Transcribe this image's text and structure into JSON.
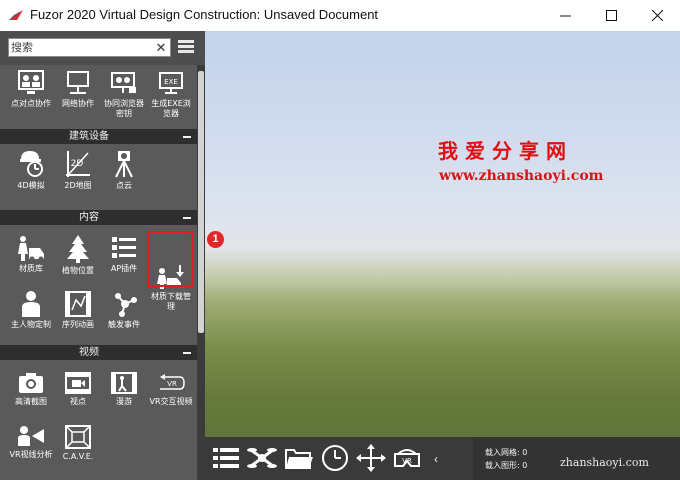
{
  "window": {
    "title": "Fuzor 2020 Virtual Design Construction: Unsaved Document",
    "minimize_glyph": "—",
    "maximize_glyph": "☐",
    "close_glyph": "✕"
  },
  "search": {
    "placeholder": "搜索",
    "clear_glyph": "✕"
  },
  "categories": {
    "top_tools": [
      {
        "label": "点对点协作",
        "icon": "peer-collab-icon"
      },
      {
        "label": "网络协作",
        "icon": "network-collab-icon"
      },
      {
        "label": "协同浏览器密钥",
        "icon": "browser-key-icon"
      },
      {
        "label": "生成EXE浏览器",
        "icon": "exe-viewer-icon"
      }
    ],
    "building": {
      "title": "建筑设备",
      "tools": [
        {
          "label": "4D模拟",
          "icon": "4d-sim-icon"
        },
        {
          "label": "2D地图",
          "icon": "2d-map-icon"
        },
        {
          "label": "点云",
          "icon": "point-cloud-icon"
        }
      ]
    },
    "content": {
      "title": "内容",
      "tools": [
        {
          "label": "材质库",
          "icon": "material-library-icon"
        },
        {
          "label": "植物位置",
          "icon": "plant-tree-icon"
        },
        {
          "label": "AP插件",
          "icon": "ap-plugin-icon"
        },
        {
          "label": "材质下载管理",
          "icon": "material-download-icon"
        },
        {
          "label": "主人物定制",
          "icon": "character-icon"
        },
        {
          "label": "序列动画",
          "icon": "sequence-anim-icon"
        },
        {
          "label": "触发事件",
          "icon": "trigger-event-icon"
        }
      ]
    },
    "video": {
      "title": "视频",
      "tools": [
        {
          "label": "高清截图",
          "icon": "camera-icon"
        },
        {
          "label": "视点",
          "icon": "viewpoint-icon"
        },
        {
          "label": "漫游",
          "icon": "walkthrough-icon"
        },
        {
          "label": "VR交互视频",
          "icon": "vr-video-icon"
        },
        {
          "label": "VR视线分析",
          "icon": "vr-sight-icon"
        },
        {
          "label": "C.A.V.E.",
          "icon": "cave-icon"
        }
      ]
    }
  },
  "annotation": {
    "badge": "1"
  },
  "watermark": {
    "cn": "我爱分享网",
    "url": "www.zhanshaoyi.com",
    "url_bottom": "zhanshaoyi.com"
  },
  "toolbar": {
    "buttons": [
      "list-icon",
      "drone-icon",
      "folder-icon",
      "clock-icon",
      "move-arrows-icon",
      "vr-headset-icon"
    ],
    "collapse_glyph": "‹"
  },
  "info": {
    "meshes": "载入网格: 0",
    "shapes": "载入图形: 0"
  },
  "colors": {
    "panel_bg": "#5a5a5a",
    "header_bg": "#2e2e2e",
    "highlight": "#e21b1b",
    "watermark": "#e01010"
  }
}
